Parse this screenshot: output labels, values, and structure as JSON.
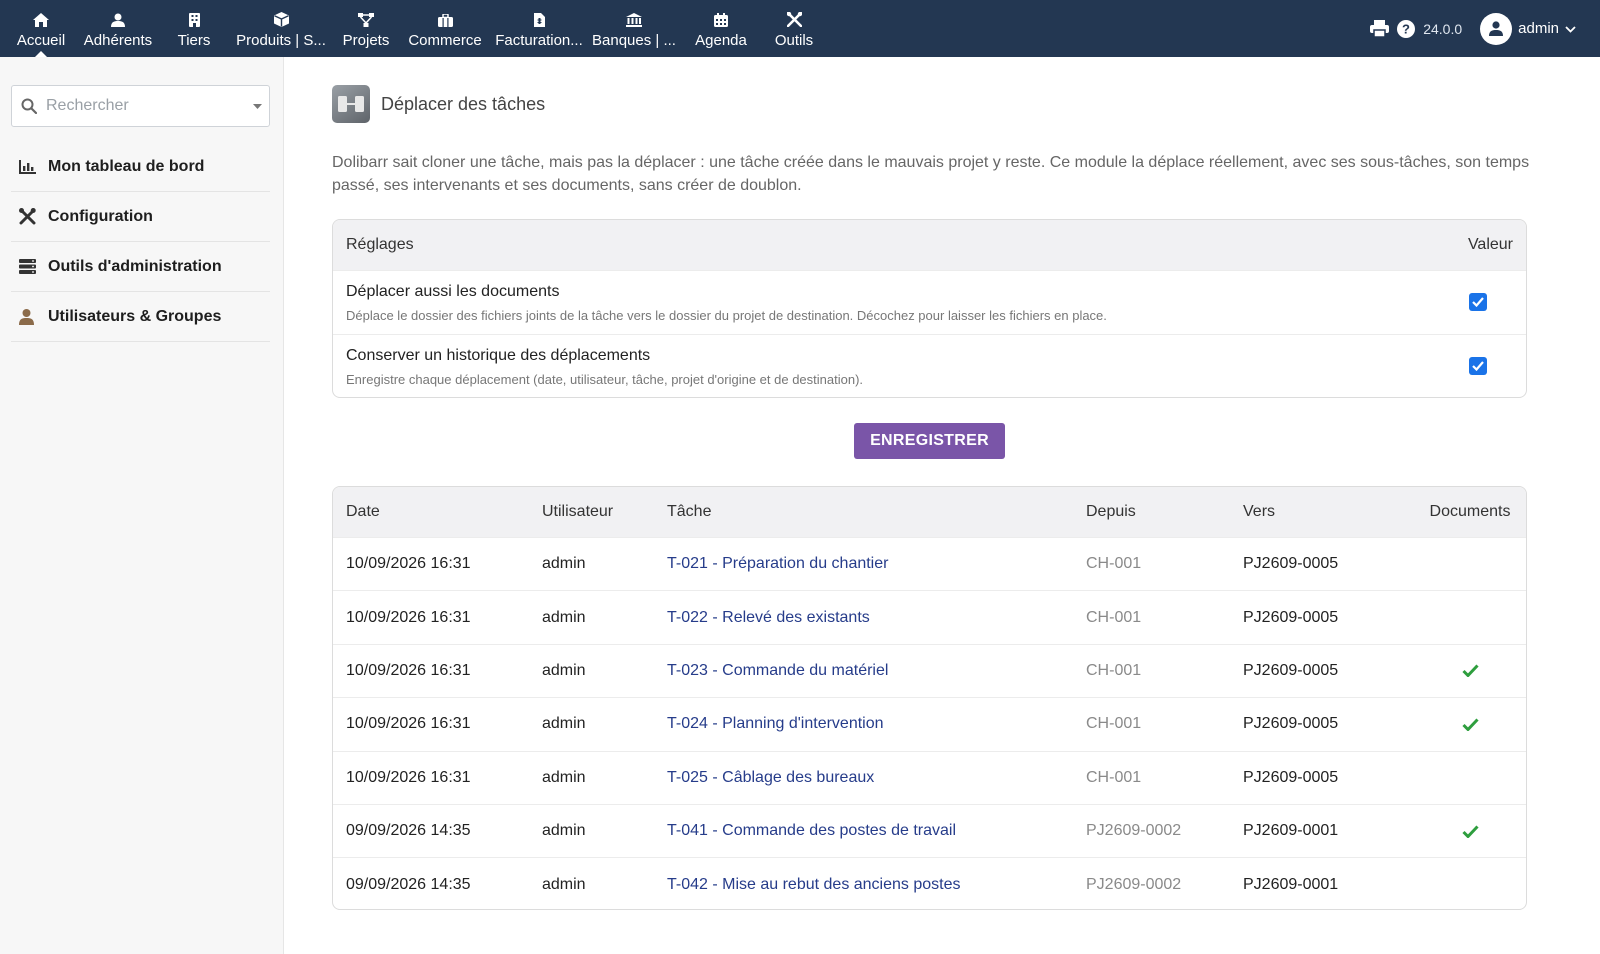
{
  "topbar": {
    "menu": [
      {
        "label": "Accueil",
        "icon": "home-icon"
      },
      {
        "label": "Adhérents",
        "icon": "user-icon"
      },
      {
        "label": "Tiers",
        "icon": "building-icon"
      },
      {
        "label": "Produits | S...",
        "icon": "cube-icon"
      },
      {
        "label": "Projets",
        "icon": "project-icon"
      },
      {
        "label": "Commerce",
        "icon": "briefcase-icon"
      },
      {
        "label": "Facturation...",
        "icon": "invoice-icon"
      },
      {
        "label": "Banques | ...",
        "icon": "bank-icon"
      },
      {
        "label": "Agenda",
        "icon": "calendar-icon"
      },
      {
        "label": "Outils",
        "icon": "tools-icon"
      }
    ],
    "version": "24.0.0",
    "user": "admin"
  },
  "sidebar": {
    "search_placeholder": "Rechercher",
    "items": [
      {
        "label": "Mon tableau de bord",
        "icon": "chart-icon"
      },
      {
        "label": "Configuration",
        "icon": "tools-icon"
      },
      {
        "label": "Outils d'administration",
        "icon": "server-icon"
      },
      {
        "label": "Utilisateurs & Groupes",
        "icon": "user-icon"
      }
    ]
  },
  "page": {
    "title": "Déplacer des tâches",
    "intro": "Dolibarr sait cloner une tâche, mais pas la déplacer : une tâche créée dans le mauvais projet y reste. Ce module la déplace réellement, avec ses sous-tâches, son temps passé, ses intervenants et ses documents, sans créer de doublon."
  },
  "settings": {
    "header_left": "Réglages",
    "header_right": "Valeur",
    "rows": [
      {
        "title": "Déplacer aussi les documents",
        "desc": "Déplace le dossier des fichiers joints de la tâche vers le dossier du projet de destination. Décochez pour laisser les fichiers en place.",
        "checked": true
      },
      {
        "title": "Conserver un historique des déplacements",
        "desc": "Enregistre chaque déplacement (date, utilisateur, tâche, projet d'origine et de destination).",
        "checked": true
      }
    ],
    "save_label": "ENREGISTRER"
  },
  "history": {
    "columns": {
      "date": "Date",
      "user": "Utilisateur",
      "task": "Tâche",
      "from": "Depuis",
      "to": "Vers",
      "docs": "Documents"
    },
    "rows": [
      {
        "date": "10/09/2026 16:31",
        "user": "admin",
        "task": "T-021 - Préparation du chantier",
        "from": "CH-001",
        "to": "PJ2609-0005",
        "docs": false
      },
      {
        "date": "10/09/2026 16:31",
        "user": "admin",
        "task": "T-022 - Relevé des existants",
        "from": "CH-001",
        "to": "PJ2609-0005",
        "docs": false
      },
      {
        "date": "10/09/2026 16:31",
        "user": "admin",
        "task": "T-023 - Commande du matériel",
        "from": "CH-001",
        "to": "PJ2609-0005",
        "docs": true
      },
      {
        "date": "10/09/2026 16:31",
        "user": "admin",
        "task": "T-024 - Planning d'intervention",
        "from": "CH-001",
        "to": "PJ2609-0005",
        "docs": true
      },
      {
        "date": "10/09/2026 16:31",
        "user": "admin",
        "task": "T-025 - Câblage des bureaux",
        "from": "CH-001",
        "to": "PJ2609-0005",
        "docs": false
      },
      {
        "date": "09/09/2026 14:35",
        "user": "admin",
        "task": "T-041 - Commande des postes de travail",
        "from": "PJ2609-0002",
        "to": "PJ2609-0001",
        "docs": true
      },
      {
        "date": "09/09/2026 14:35",
        "user": "admin",
        "task": "T-042 - Mise au rebut des anciens postes",
        "from": "PJ2609-0002",
        "to": "PJ2609-0001",
        "docs": false
      }
    ]
  },
  "colors": {
    "topbar": "#233752",
    "accent_button": "#7a55a8",
    "link": "#263c8a",
    "check": "#2e9e3e",
    "checkbox": "#1a73e8"
  }
}
